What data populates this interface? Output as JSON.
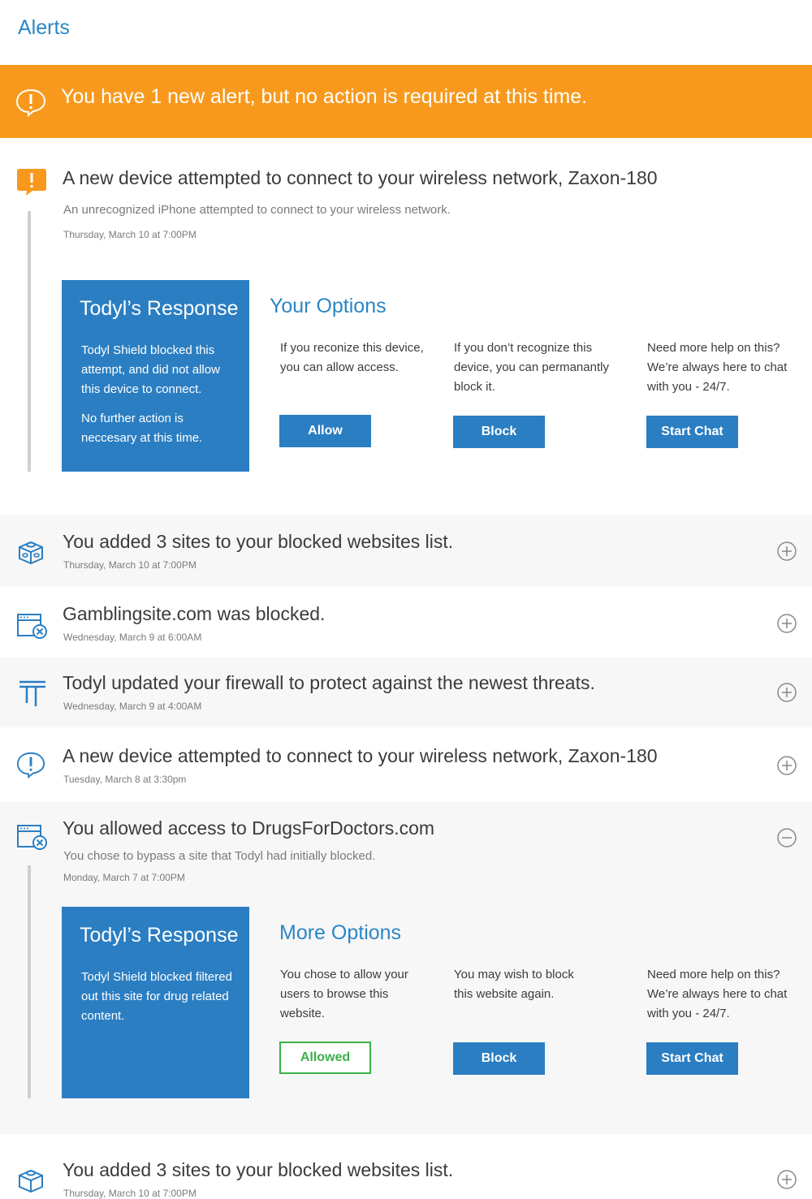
{
  "header": {
    "title": "Alerts"
  },
  "banner": {
    "text": "You have 1 new alert, but no action is required at this time."
  },
  "alert1": {
    "title": "A new device attempted to connect to your wireless network, Zaxon-180",
    "subtitle": "An unrecognized iPhone attempted to connect to your wireless network.",
    "date": "Thursday, March 10 at 7:00PM",
    "response_title": "Todyl’s Response",
    "response_p1": "Todyl Shield blocked this attempt, and did not allow this device to connect.",
    "response_p2": "No further action is neccesary at this time.",
    "options_title": "Your Options",
    "opt1_text": "If you reconize this device, you can allow access.",
    "opt1_button": "Allow",
    "opt2_text": "If  you don’t recognize this device, you can permanantly block it.",
    "opt2_button": "Block",
    "opt3_text": "Need more help on this? We’re always here to chat with you - 24/7.",
    "opt3_button": "Start Chat"
  },
  "rows": [
    {
      "title": "You added 3 sites to your blocked websites list.",
      "date": "Thursday, March 10 at 7:00PM"
    },
    {
      "title": "Gamblingsite.com was blocked.",
      "date": "Wednesday, March 9 at 6:00AM"
    },
    {
      "title": "Todyl updated your firewall to protect against the newest threats.",
      "date": "Wednesday, March 9 at 4:00AM"
    },
    {
      "title": "A new device attempted to connect to your wireless network, Zaxon-180",
      "date": "Tuesday, March 8 at 3:30pm"
    }
  ],
  "alert2": {
    "title": "You allowed access to DrugsForDoctors.com",
    "subtitle": "You chose to bypass a site that Todyl had initially blocked.",
    "date": "Monday, March 7 at 7:00PM",
    "response_title": "Todyl’s Response",
    "response_p1": "Todyl Shield blocked filtered out this site for drug related content.",
    "options_title": "More Options",
    "opt1_text": "You chose to allow your users to browse this website.",
    "opt1_button": "Allowed",
    "opt2_text": "You may wish to block this website again.",
    "opt2_button": "Block",
    "opt3_text": "Need more help on this? We’re always here to chat with you - 24/7.",
    "opt3_button": "Start Chat"
  },
  "last_row": {
    "title": "You added 3 sites to your blocked websites list.",
    "date": "Thursday, March 10 at 7:00PM"
  },
  "colors": {
    "accent": "#2b7ec2",
    "banner": "#f8991d",
    "allowed": "#3cb04a"
  },
  "icons": [
    "alert-bubble-icon",
    "blocks-icon",
    "browser-blocked-icon",
    "firewall-icon",
    "expand-plus-icon",
    "collapse-minus-icon"
  ]
}
